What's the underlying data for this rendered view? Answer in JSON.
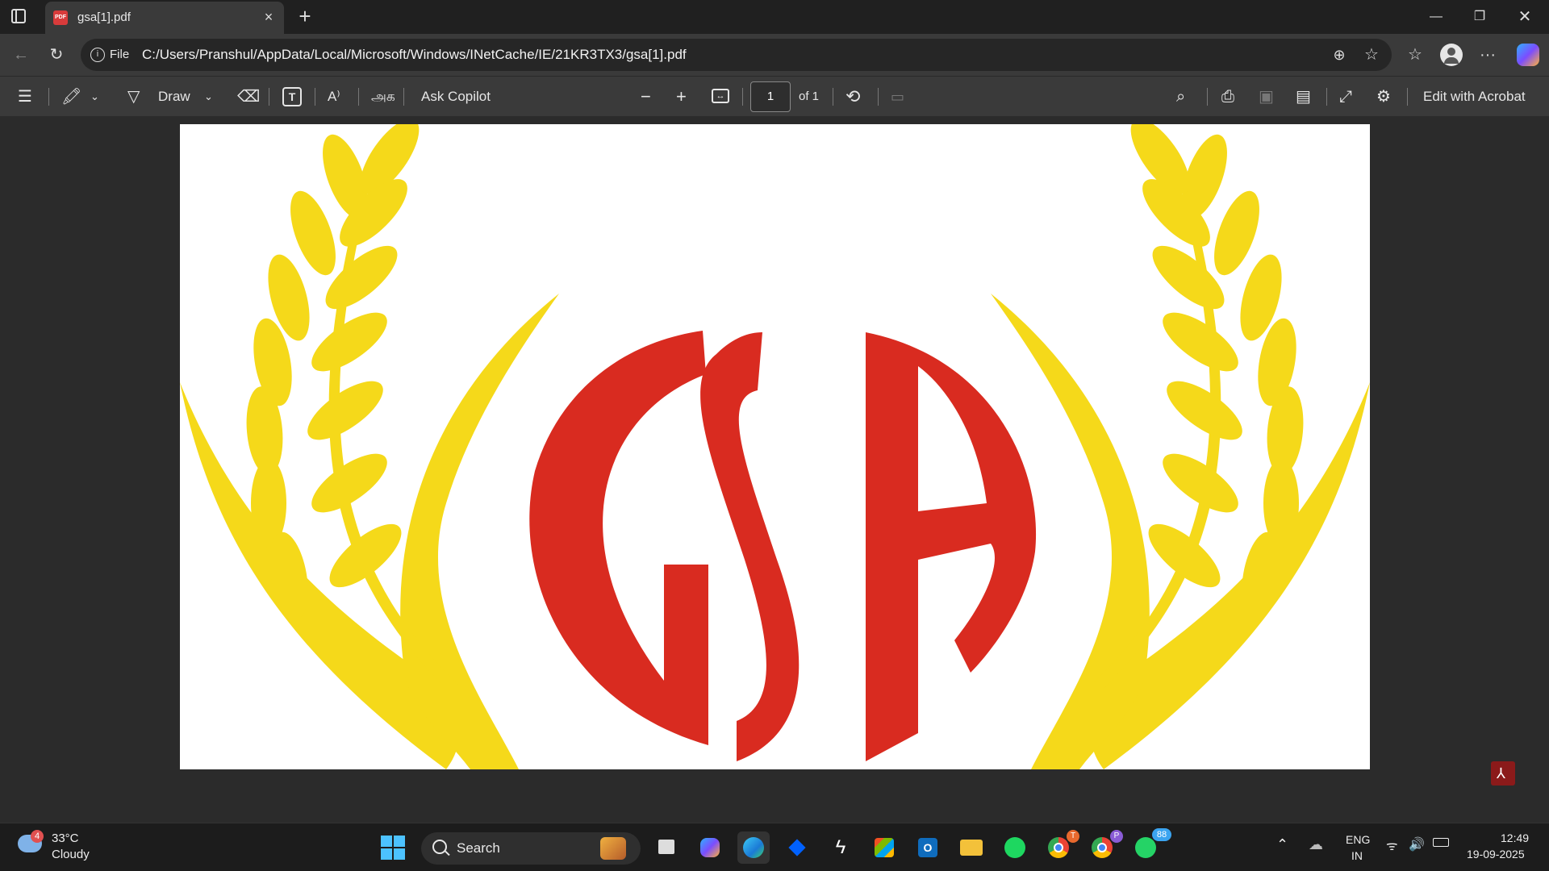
{
  "browser": {
    "tab_title": "gsa[1].pdf",
    "tab_badge": "PDF",
    "scheme_label": "File",
    "url": "C:/Users/Pranshul/AppData/Local/Microsoft/Windows/INetCache/IE/21KR3TX3/gsa[1].pdf"
  },
  "pdf_toolbar": {
    "draw_label": "Draw",
    "read_aloud_label": "A⁾",
    "translate_label": "அக",
    "copilot_label": "Ask Copilot",
    "page_number": "1",
    "page_total": "of 1",
    "acrobat_label": "Edit with Acrobat"
  },
  "document": {
    "logo_text": "GSA",
    "colors": {
      "wheat": "#f5d91a",
      "letters": "#d92b20"
    }
  },
  "taskbar": {
    "weather_temp": "33°C",
    "weather_desc": "Cloudy",
    "weather_badge": "4",
    "search_label": "Search",
    "chrome1_badge": "T",
    "chrome2_badge": "P",
    "whatsapp_badge": "88",
    "lang_top": "ENG",
    "lang_bottom": "IN",
    "time": "12:49",
    "date": "19-09-2025"
  }
}
